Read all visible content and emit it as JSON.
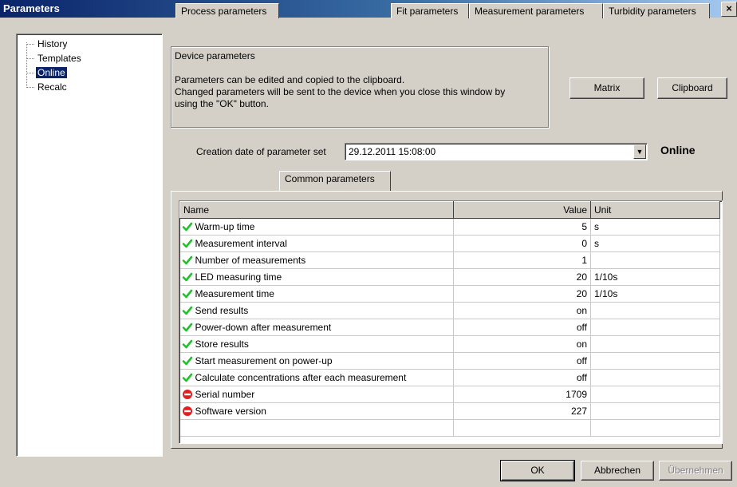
{
  "window": {
    "title": "Parameters",
    "close_glyph": "×"
  },
  "tree": {
    "items": [
      {
        "label": "History",
        "selected": false
      },
      {
        "label": "Templates",
        "selected": false
      },
      {
        "label": "Online",
        "selected": true
      },
      {
        "label": "Recalc",
        "selected": false
      }
    ]
  },
  "info": {
    "title": "Device parameters",
    "line1": "Parameters can be edited and copied to the clipboard.",
    "line2": "Changed parameters will be sent to the device when you close this window by",
    "line3": "using the \"OK\" button."
  },
  "buttons": {
    "matrix": "Matrix",
    "clipboard": "Clipboard",
    "ok": "OK",
    "cancel": "Abbrechen",
    "apply": "Übernehmen"
  },
  "creation": {
    "label": "Creation date of parameter set",
    "value": "29.12.2011 15:08:00",
    "status": "Online"
  },
  "tabs": [
    {
      "label": "Process parameters",
      "active": false
    },
    {
      "label": "Common parameters",
      "active": true
    },
    {
      "label": "Fit parameters",
      "active": false
    },
    {
      "label": "Measurement parameters",
      "active": false
    },
    {
      "label": "Turbidity parameters",
      "active": false
    }
  ],
  "grid": {
    "columns": {
      "name": "Name",
      "value": "Value",
      "unit": "Unit"
    },
    "rows": [
      {
        "name": "Warm-up time",
        "value": "5",
        "unit": "s",
        "icon": "check-icon"
      },
      {
        "name": "Measurement interval",
        "value": "0",
        "unit": "s",
        "icon": "check-icon"
      },
      {
        "name": "Number of measurements",
        "value": "1",
        "unit": "",
        "icon": "check-icon"
      },
      {
        "name": "LED measuring time",
        "value": "20",
        "unit": "1/10s",
        "icon": "check-icon"
      },
      {
        "name": "Measurement time",
        "value": "20",
        "unit": "1/10s",
        "icon": "check-icon"
      },
      {
        "name": "Send results",
        "value": "on",
        "unit": "",
        "icon": "check-icon"
      },
      {
        "name": "Power-down after measurement",
        "value": "off",
        "unit": "",
        "icon": "check-icon"
      },
      {
        "name": "Store results",
        "value": "on",
        "unit": "",
        "icon": "check-icon"
      },
      {
        "name": "Start measurement on power-up",
        "value": "off",
        "unit": "",
        "icon": "check-icon"
      },
      {
        "name": "Calculate concentrations after each measurement",
        "value": "off",
        "unit": "",
        "icon": "check-icon"
      },
      {
        "name": "Serial number",
        "value": "1709",
        "unit": "",
        "icon": "no-entry-icon"
      },
      {
        "name": "Software version",
        "value": "227",
        "unit": "",
        "icon": "no-entry-icon"
      }
    ]
  },
  "colors": {
    "titlebar": "#0a246a",
    "check": "#22c02a",
    "no_entry": "#e02020",
    "selection": "#0a246a"
  }
}
